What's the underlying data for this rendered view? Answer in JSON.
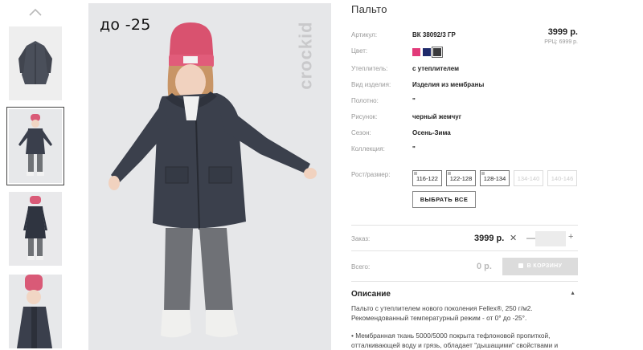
{
  "gallery": {
    "photo_tag": "до -25",
    "brand_watermark": "crockid",
    "thumbnails": [
      {
        "alt": "coat-flat"
      },
      {
        "alt": "child-front"
      },
      {
        "alt": "child-back"
      },
      {
        "alt": "child-closeup"
      }
    ],
    "active_thumbnail": 1
  },
  "product": {
    "title": "Пальто",
    "price": "3999 р.",
    "rrc": "РРЦ: 6999 р.",
    "article_label": "Артикул:",
    "article_value": "ВК 38092/3 ГР",
    "color_label": "Цвет:",
    "colors": [
      "#e23b7a",
      "#1f2a6b",
      "#3a3a3c"
    ],
    "insulation_label": "Утеплитель:",
    "insulation_value": "с утеплителем",
    "type_label": "Вид изделия:",
    "type_value": "Изделия из мембраны",
    "fabric_label": "Полотно:",
    "fabric_value": "\"",
    "pattern_label": "Рисунок:",
    "pattern_value": "черный жемчуг",
    "season_label": "Сезон:",
    "season_value": "Осень-Зима",
    "collection_label": "Коллекция:",
    "collection_value": "\"",
    "size_label": "Рост/размер:",
    "sizes": [
      {
        "label": "116-122",
        "available": true
      },
      {
        "label": "122-128",
        "available": true
      },
      {
        "label": "128-134",
        "available": true
      },
      {
        "label": "134-140",
        "available": false
      },
      {
        "label": "140-146",
        "available": false
      }
    ],
    "select_all": "ВЫБРАТЬ ВСЕ"
  },
  "order": {
    "order_label": "Заказ:",
    "order_price": "3999 р.",
    "remove_glyph": "✕",
    "minus_glyph": "—",
    "plus_glyph": "+",
    "quantity": "",
    "total_label": "Всего:",
    "total_value": "0 р.",
    "cart_button": "В КОРЗИНУ"
  },
  "description": {
    "title": "Описание",
    "caret": "▲",
    "lines": [
      "Пальто с утеплителем нового поколения Fellex®, 250 г/м2.",
      "Рекомендованный температурный режим - от 0° до -25°.",
      "",
      "• Мембранная ткань 5000/5000 покрыта тефлоновой пропиткой,",
      "отталкивающей воду и грязь, обладает \"дышащими\" свойствами и"
    ]
  }
}
